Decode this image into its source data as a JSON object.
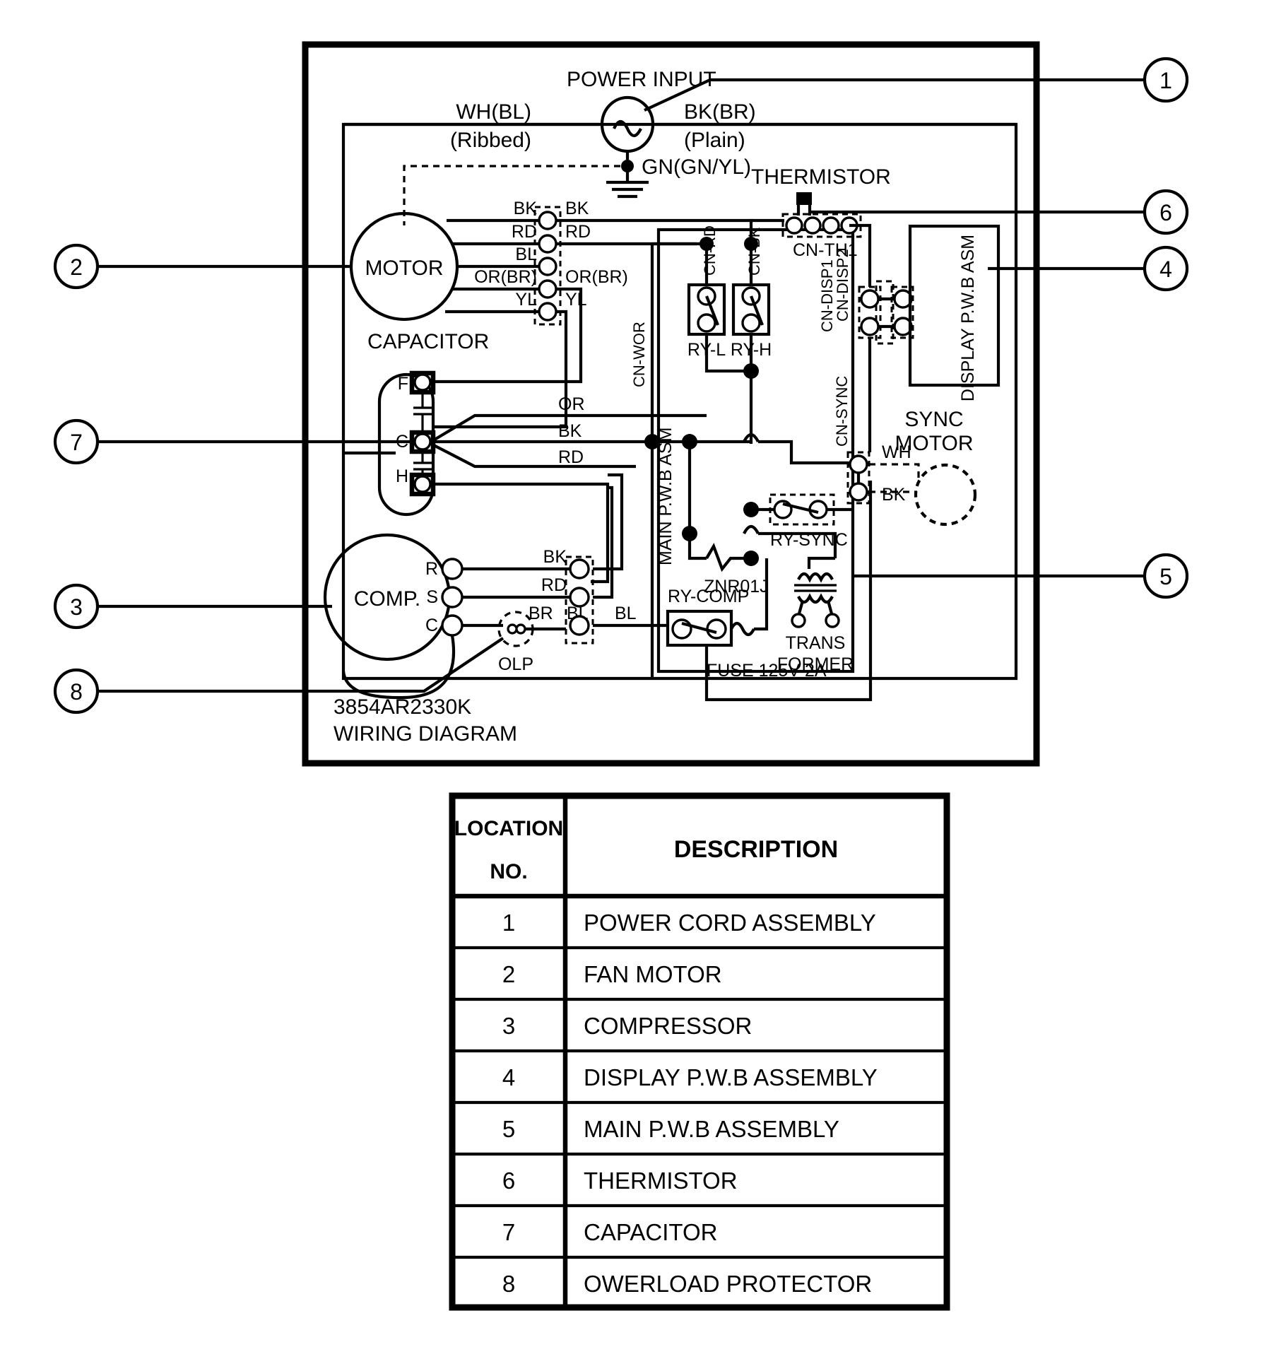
{
  "diagram": {
    "part_number": "3854AR2330K",
    "title": "WIRING DIAGRAM",
    "power_input": {
      "label": "POWER INPUT",
      "left_wire": "WH(BL)",
      "left_note": "(Ribbed)",
      "right_wire": "BK(BR)",
      "right_note": "(Plain)",
      "ground": "GN(GN/YL)"
    },
    "fan_motor": {
      "label": "MOTOR",
      "wires_left": [
        "BK",
        "RD",
        "BL",
        "OR(BR)",
        "YL"
      ],
      "wires_right": [
        "BK",
        "RD",
        "OR(BR)",
        "YL"
      ]
    },
    "capacitor": {
      "label": "CAPACITOR",
      "terminals": [
        "F",
        "C",
        "H"
      ],
      "wires": [
        "OR",
        "BK",
        "RD"
      ]
    },
    "compressor": {
      "label": "COMP.",
      "terminals": [
        "R",
        "S",
        "C"
      ],
      "wires": [
        "BK",
        "RD",
        "BL"
      ],
      "olp_wire": "BR",
      "olp_out": "BL",
      "olp_label": "OLP"
    },
    "main_pwb": {
      "label": "MAIN P.W.B ASM",
      "relays": [
        "RY-L",
        "RY-H"
      ],
      "relay_comp": "RY-COMP",
      "relay_sync": "RY-SYNC",
      "varistor": "ZNR01J",
      "transformer": [
        "TRANS",
        "FORMER"
      ],
      "fuse": "FUSE 125V 2A",
      "connectors": [
        "CN-RD",
        "CN-BK",
        "CN-WOR",
        "CN-TH1",
        "CN-DISP1",
        "CN-DISP2",
        "CN-SYNC"
      ]
    },
    "thermistor": {
      "label": "THERMISTOR",
      "connector": "CN-TH1"
    },
    "display_pwb": {
      "label": "DISPLAY P.W.B ASM"
    },
    "sync_motor": {
      "label_line1": "SYNC",
      "label_line2": "MOTOR",
      "wires": [
        "WH",
        "BK"
      ]
    },
    "callouts": [
      {
        "num": "1",
        "side": "right"
      },
      {
        "num": "6",
        "side": "right"
      },
      {
        "num": "4",
        "side": "right"
      },
      {
        "num": "5",
        "side": "right"
      },
      {
        "num": "2",
        "side": "left"
      },
      {
        "num": "7",
        "side": "left"
      },
      {
        "num": "3",
        "side": "left"
      },
      {
        "num": "8",
        "side": "left"
      }
    ]
  },
  "legend_table": {
    "header_location_line1": "LOCATION",
    "header_location_line2": "NO.",
    "header_description": "DESCRIPTION",
    "rows": [
      {
        "no": "1",
        "description": "POWER CORD ASSEMBLY"
      },
      {
        "no": "2",
        "description": "FAN MOTOR"
      },
      {
        "no": "3",
        "description": "COMPRESSOR"
      },
      {
        "no": "4",
        "description": "DISPLAY P.W.B ASSEMBLY"
      },
      {
        "no": "5",
        "description": "MAIN P.W.B ASSEMBLY"
      },
      {
        "no": "6",
        "description": "THERMISTOR"
      },
      {
        "no": "7",
        "description": "CAPACITOR"
      },
      {
        "no": "8",
        "description": "OWERLOAD PROTECTOR"
      }
    ]
  },
  "colors": {
    "ink": "#000000",
    "paper": "#ffffff"
  }
}
